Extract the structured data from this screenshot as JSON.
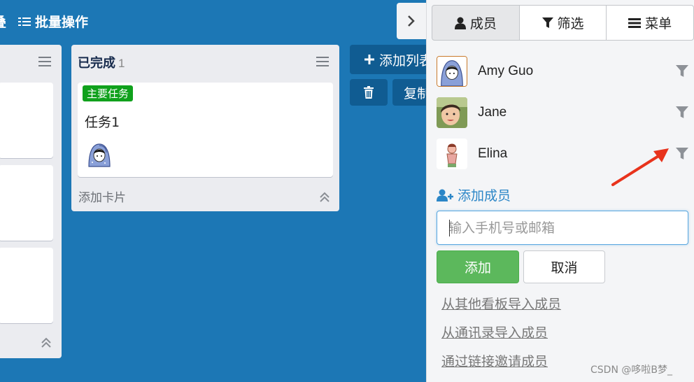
{
  "toolbar": {
    "partial_label": "叠",
    "batch_label": "批量操作"
  },
  "lists": {
    "done": {
      "title": "已完成",
      "count": "1",
      "card": {
        "label": "主要任务",
        "label_color": "#10a11c",
        "title": "任务1"
      },
      "add_card": "添加卡片"
    }
  },
  "board_actions": {
    "add_list": "添加列表",
    "copy": "复制"
  },
  "panel": {
    "tabs": [
      {
        "label": "成员",
        "icon": "user-icon"
      },
      {
        "label": "筛选",
        "icon": "filter-icon"
      },
      {
        "label": "菜单",
        "icon": "menu-icon"
      }
    ],
    "members": [
      {
        "name": "Amy Guo"
      },
      {
        "name": "Jane"
      },
      {
        "name": "Elina"
      }
    ],
    "add_member": "添加成员",
    "input_placeholder": "输入手机号或邮箱",
    "add_button": "添加",
    "cancel_button": "取消",
    "links": [
      "从其他看板导入成员",
      "从通讯录导入成员",
      "通过链接邀请成员"
    ]
  },
  "watermark": "CSDN @哆啦B梦_",
  "colors": {
    "board_bg": "#1c77b5",
    "accent_green": "#5cb85c",
    "link_blue": "#2b86c7",
    "arrow_red": "#e8331c"
  }
}
